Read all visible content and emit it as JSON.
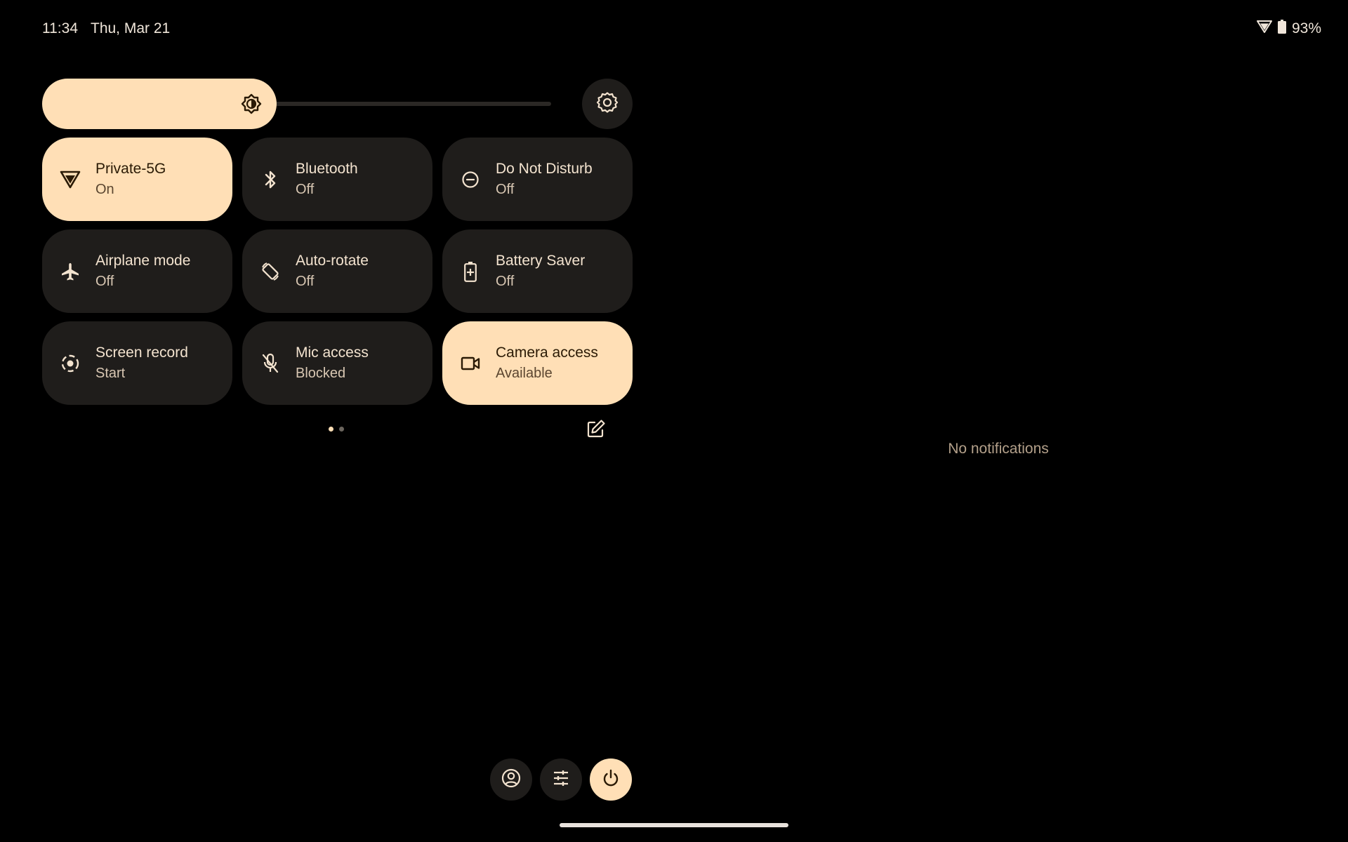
{
  "status_bar": {
    "time": "11:34",
    "date": "Thu, Mar 21",
    "battery_percent": "93%",
    "icons": [
      "wifi-icon",
      "battery-icon"
    ]
  },
  "brightness": {
    "level": 0.46,
    "icon": "brightness-icon"
  },
  "settings": {
    "icon": "gear-icon"
  },
  "tiles": [
    {
      "label": "Private-5G",
      "state": "On",
      "icon": "wifi-icon",
      "active": true
    },
    {
      "label": "Bluetooth",
      "state": "Off",
      "icon": "bluetooth-icon",
      "active": false
    },
    {
      "label": "Do Not Disturb",
      "state": "Off",
      "icon": "do-not-disturb-icon",
      "active": false
    },
    {
      "label": "Airplane mode",
      "state": "Off",
      "icon": "airplane-icon",
      "active": false
    },
    {
      "label": "Auto-rotate",
      "state": "Off",
      "icon": "rotate-icon",
      "active": false
    },
    {
      "label": "Battery Saver",
      "state": "Off",
      "icon": "battery-saver-icon",
      "active": false
    },
    {
      "label": "Screen record",
      "state": "Start",
      "icon": "screen-record-icon",
      "active": false
    },
    {
      "label": "Mic access",
      "state": "Blocked",
      "icon": "mic-off-icon",
      "active": false
    },
    {
      "label": "Camera access",
      "state": "Available",
      "icon": "camera-icon",
      "active": true
    }
  ],
  "pager": {
    "pages": 2,
    "current": 1
  },
  "notifications": {
    "empty_text": "No notifications"
  },
  "footer": {
    "buttons": [
      "user-icon",
      "sliders-icon",
      "power-icon"
    ]
  },
  "colors": {
    "accent": "#ffdfb6",
    "tile_bg": "#1f1d1b",
    "background": "#000000"
  }
}
